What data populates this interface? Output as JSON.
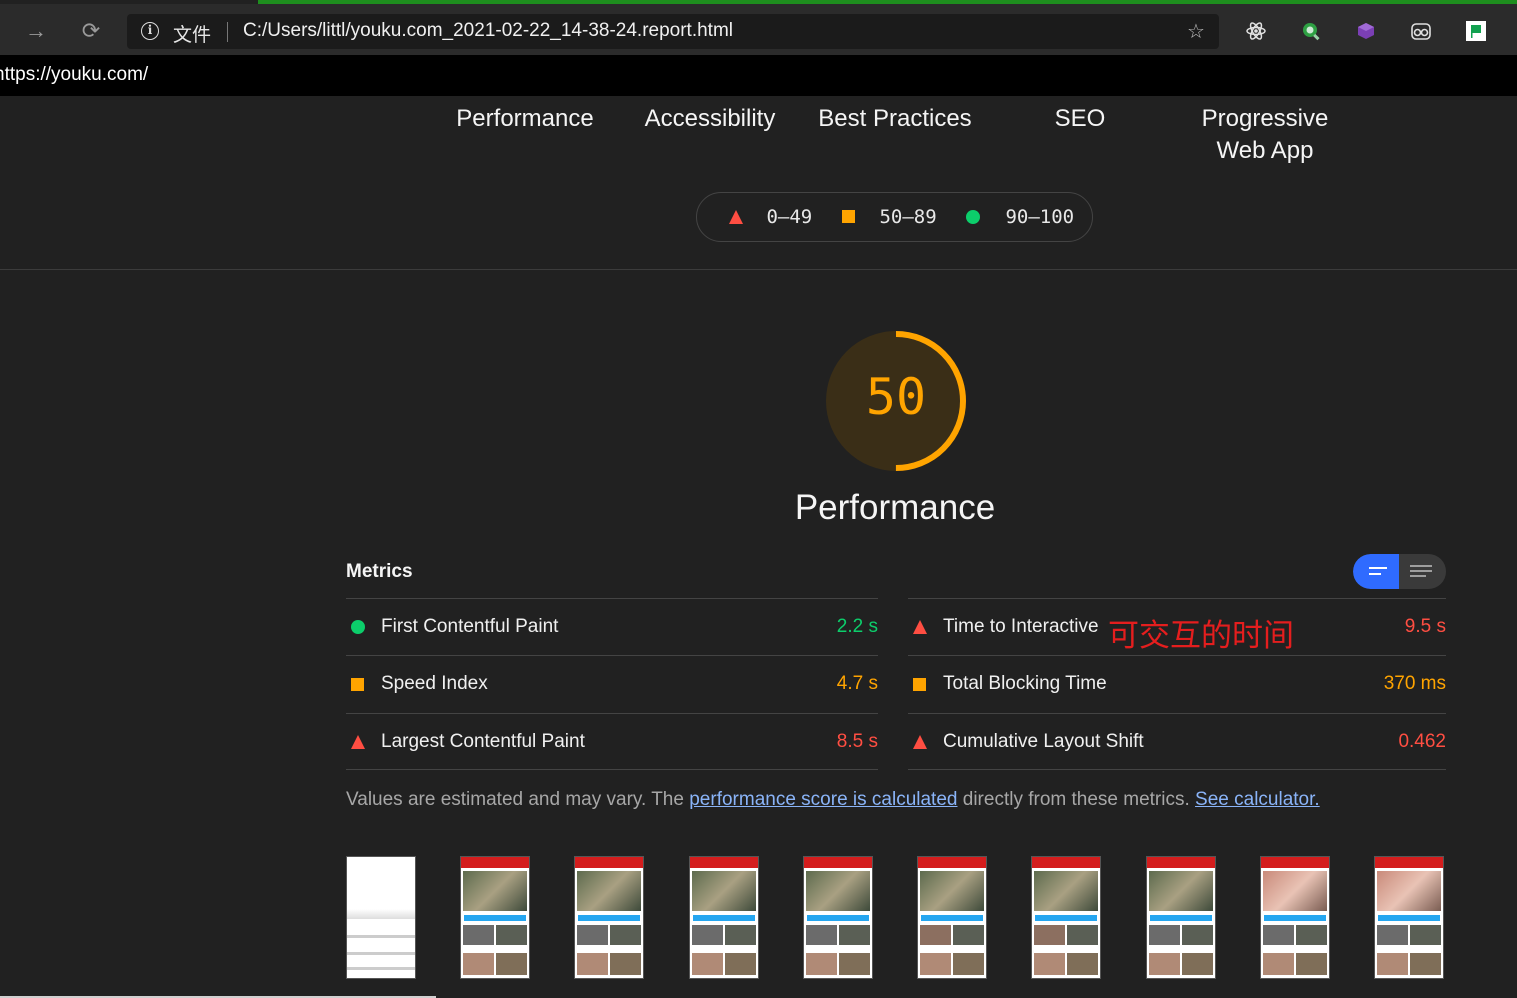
{
  "browser": {
    "file_label": "文件",
    "address": "C:/Users/littl/youku.com_2021-02-22_14-38-24.report.html",
    "page_url": "https://youku.com/"
  },
  "categories": [
    "Performance",
    "Accessibility",
    "Best Practices",
    "SEO",
    "Progressive Web App"
  ],
  "legend": {
    "fail": "0–49",
    "average": "50–89",
    "pass": "90–100"
  },
  "gauge": {
    "score": "50",
    "score_fraction": 0.5,
    "title": "Performance",
    "color": "#ffa400"
  },
  "metrics": {
    "heading": "Metrics",
    "items": [
      {
        "label": "First Contentful Paint",
        "value": "2.2 s",
        "rating": "pass"
      },
      {
        "label": "Time to Interactive",
        "value": "9.5 s",
        "rating": "fail"
      },
      {
        "label": "Speed Index",
        "value": "4.7 s",
        "rating": "average"
      },
      {
        "label": "Total Blocking Time",
        "value": "370 ms",
        "rating": "average"
      },
      {
        "label": "Largest Contentful Paint",
        "value": "8.5 s",
        "rating": "fail"
      },
      {
        "label": "Cumulative Layout Shift",
        "value": "0.462",
        "rating": "fail"
      }
    ],
    "annotation": "可交互的时间"
  },
  "note": {
    "text1": "Values are estimated and may vary. The ",
    "link1": "performance score is calculated",
    "text2": " directly from these metrics. ",
    "link2": "See calculator."
  },
  "colors": {
    "pass": "#0cce6b",
    "average": "#ffa400",
    "fail": "#ff4e42"
  }
}
